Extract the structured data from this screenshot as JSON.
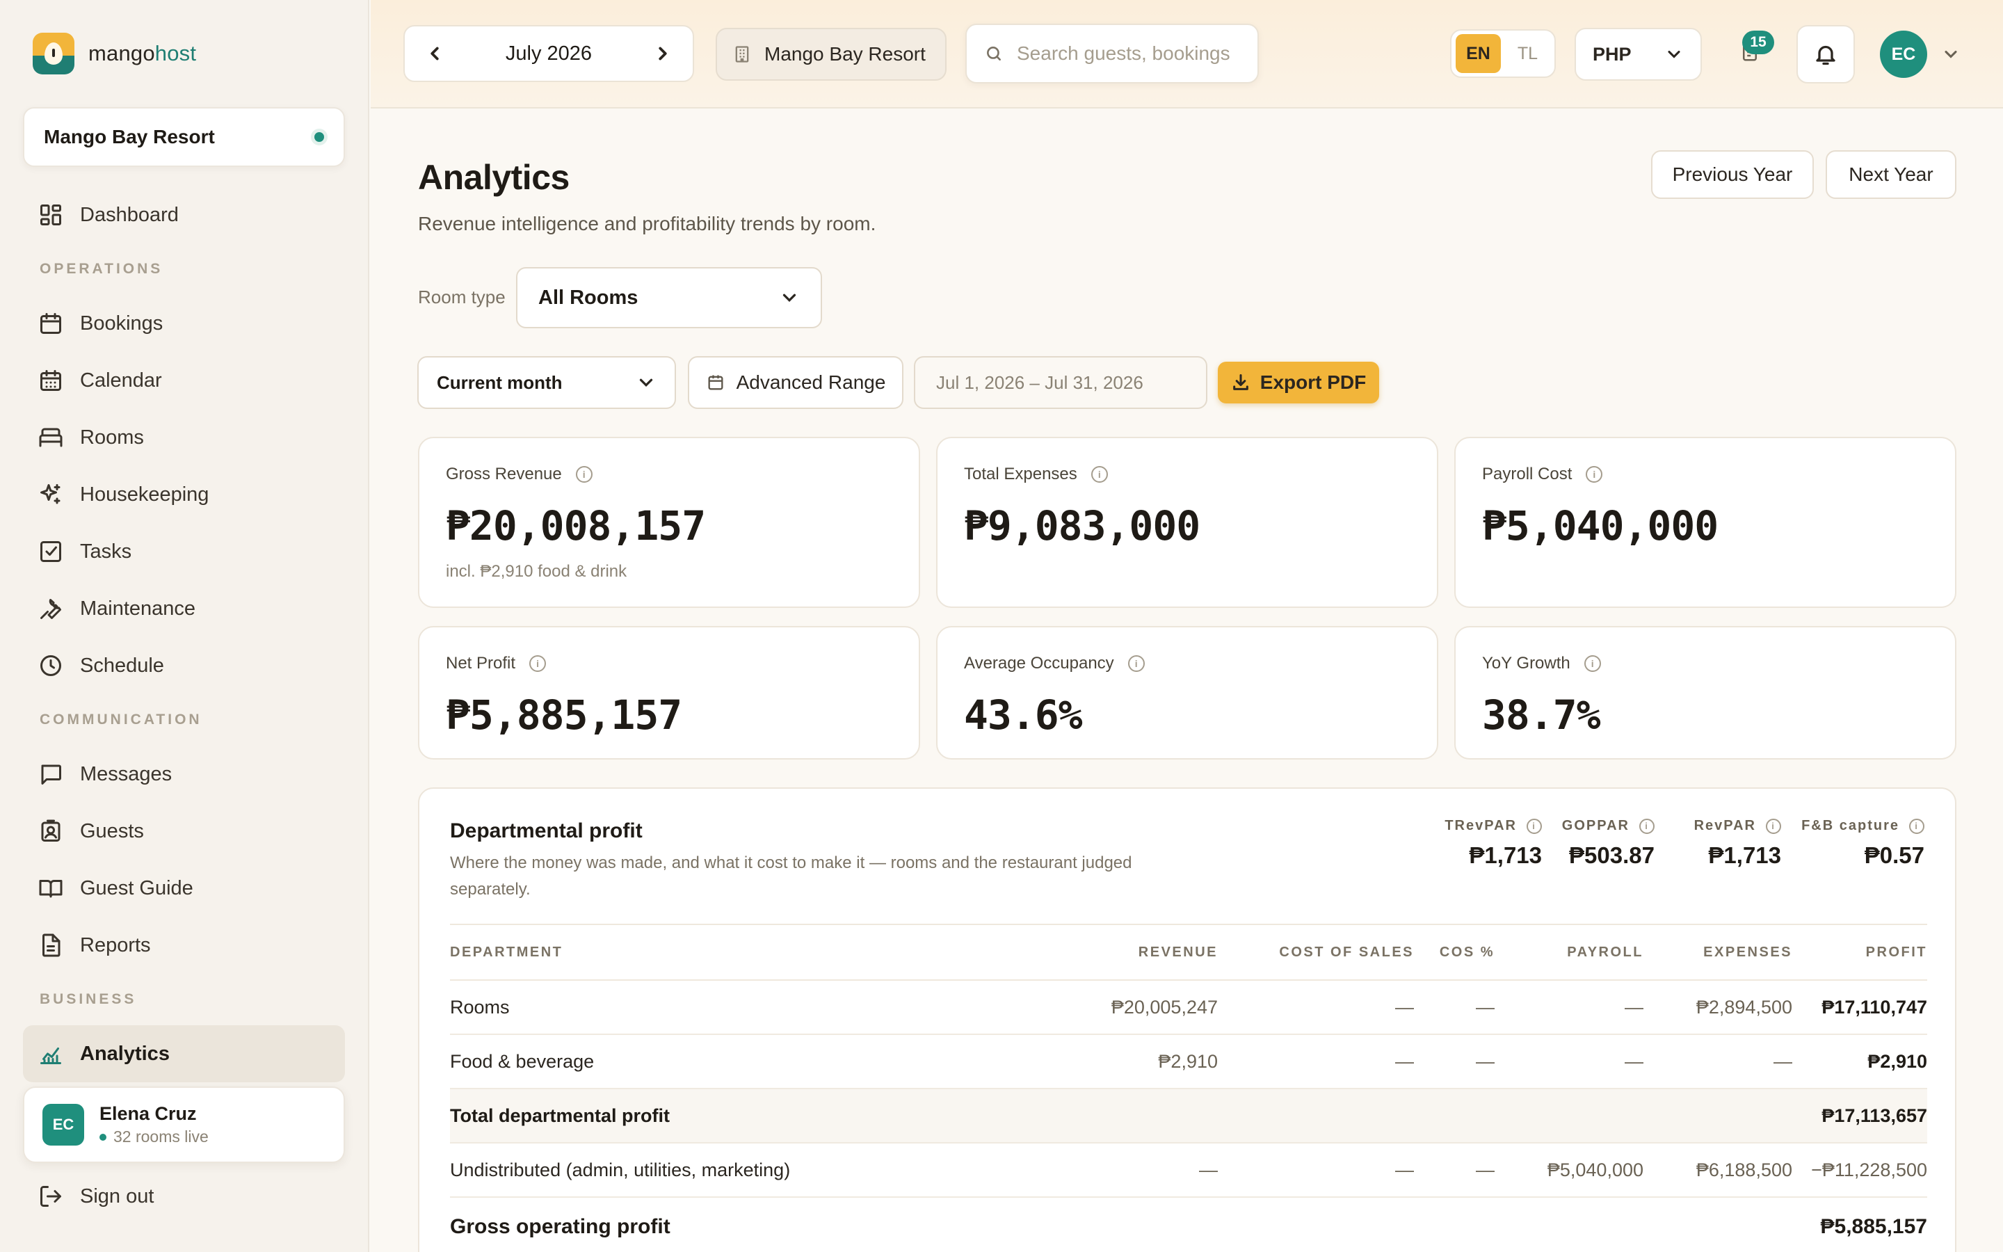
{
  "brand": {
    "name_main": "mango",
    "name_accent": "host"
  },
  "sidebar": {
    "property_name": "Mango Bay Resort",
    "sections": {
      "operations": "OPERATIONS",
      "communication": "COMMUNICATION",
      "business": "BUSINESS"
    },
    "items": [
      {
        "label": "Dashboard",
        "icon": "grid-icon"
      },
      {
        "label": "Bookings",
        "icon": "calendar-icon"
      },
      {
        "label": "Calendar",
        "icon": "calendar-grid-icon"
      },
      {
        "label": "Rooms",
        "icon": "bed-icon"
      },
      {
        "label": "Housekeeping",
        "icon": "sparkles-icon"
      },
      {
        "label": "Tasks",
        "icon": "checkbox-icon"
      },
      {
        "label": "Maintenance",
        "icon": "wrench-icon"
      },
      {
        "label": "Schedule",
        "icon": "clock-icon"
      },
      {
        "label": "Messages",
        "icon": "message-icon"
      },
      {
        "label": "Guests",
        "icon": "id-badge-icon"
      },
      {
        "label": "Guest Guide",
        "icon": "book-icon"
      },
      {
        "label": "Reports",
        "icon": "document-icon"
      },
      {
        "label": "Analytics",
        "icon": "chart-icon",
        "active": true
      }
    ],
    "user": {
      "initials": "EC",
      "name": "Elena Cruz",
      "status": "32 rooms live"
    },
    "signout": "Sign out"
  },
  "topbar": {
    "month": "July 2026",
    "property": "Mango Bay Resort",
    "search_placeholder": "Search guests, bookings",
    "lang": {
      "en": "EN",
      "tl": "TL",
      "selected": "EN"
    },
    "currency": "PHP",
    "notifications_count": "15",
    "user_initials": "EC"
  },
  "page": {
    "title": "Analytics",
    "subtitle": "Revenue intelligence and profitability trends by room.",
    "prev_year": "Previous Year",
    "next_year": "Next Year",
    "room_type_label": "Room type",
    "room_type_value": "All Rooms",
    "range_value": "Current month",
    "advanced_range": "Advanced Range",
    "date_range": "Jul 1, 2026 – Jul 31, 2026",
    "export": "Export PDF"
  },
  "kpis": [
    {
      "label": "Gross Revenue",
      "value": "₱20,008,157",
      "note": "incl. ₱2,910 food & drink"
    },
    {
      "label": "Total Expenses",
      "value": "₱9,083,000"
    },
    {
      "label": "Payroll Cost",
      "value": "₱5,040,000"
    },
    {
      "label": "Net Profit",
      "value": "₱5,885,157"
    },
    {
      "label": "Average Occupancy",
      "value": "43.6%"
    },
    {
      "label": "YoY Growth",
      "value": "38.7%"
    }
  ],
  "departmental": {
    "title": "Departmental profit",
    "description": "Where the money was made, and what it cost to make it — rooms and the restaurant judged separately.",
    "metrics": [
      {
        "label": "TRevPAR",
        "value": "₱1,713"
      },
      {
        "label": "GOPPAR",
        "value": "₱503.87"
      },
      {
        "label": "RevPAR",
        "value": "₱1,713"
      },
      {
        "label": "F&B capture",
        "value": "₱0.57"
      }
    ],
    "columns": [
      "DEPARTMENT",
      "REVENUE",
      "COST OF SALES",
      "COS %",
      "PAYROLL",
      "EXPENSES",
      "PROFIT"
    ],
    "rows": [
      {
        "department": "Rooms",
        "revenue": "₱20,005,247",
        "cos": "—",
        "cos_pct": "—",
        "payroll": "—",
        "expenses": "₱2,894,500",
        "profit": "₱17,110,747"
      },
      {
        "department": "Food & beverage",
        "revenue": "₱2,910",
        "cos": "—",
        "cos_pct": "—",
        "payroll": "—",
        "expenses": "—",
        "profit": "₱2,910"
      }
    ],
    "total": {
      "label": "Total departmental profit",
      "profit": "₱17,113,657"
    },
    "undistributed": {
      "department": "Undistributed (admin, utilities, marketing)",
      "revenue": "—",
      "cos": "—",
      "cos_pct": "—",
      "payroll": "₱5,040,000",
      "expenses": "₱6,188,500",
      "profit": "−₱11,228,500"
    },
    "gop": {
      "label": "Gross operating profit",
      "profit": "₱5,885,157"
    }
  }
}
